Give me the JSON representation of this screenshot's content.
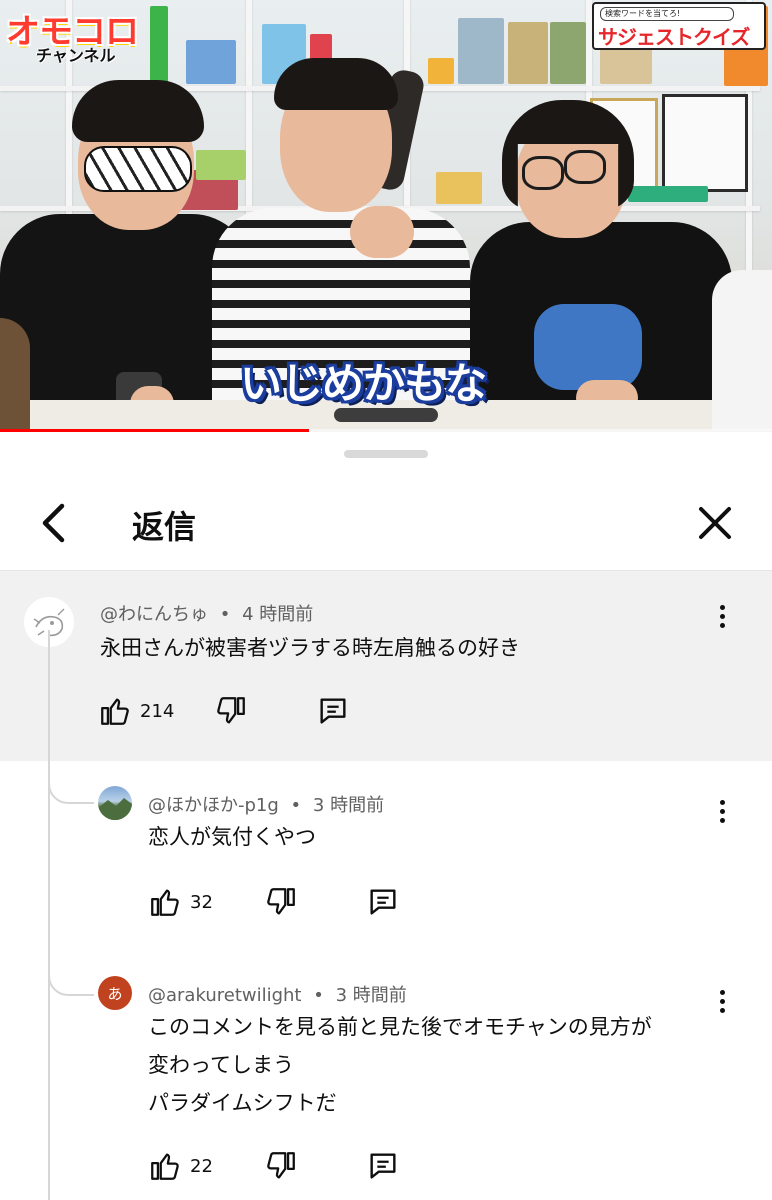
{
  "video": {
    "channel_logo": "オモコロ",
    "channel_logo_sub": "チャンネル",
    "quiz_badge_search": "検索ワードを当てろ!",
    "quiz_badge_title": "サジェストクイズ",
    "caption": "いじめかもな",
    "progress": 0.4
  },
  "sheet": {
    "title": "返信",
    "back_icon": "chevron-left-icon",
    "close_icon": "close-icon"
  },
  "comments": [
    {
      "author": "@わにんちゅ",
      "separator": "•",
      "time": "4 時間前",
      "lines": [
        "永田さんが被害者ヅラする時左肩触るの好き"
      ],
      "likes": "214",
      "avatar_kind": "sketch"
    },
    {
      "author": "@ほかほか-p1g",
      "separator": "•",
      "time": "3 時間前",
      "lines": [
        "恋人が気付くやつ"
      ],
      "likes": "32",
      "avatar_kind": "landscape"
    },
    {
      "author": "@arakuretwilight",
      "separator": "•",
      "time": "3 時間前",
      "lines": [
        "このコメントを見る前と見た後でオモチャンの見方が",
        "変わってしまう",
        "パラダイムシフトだ"
      ],
      "likes": "22",
      "avatar_kind": "letter",
      "avatar_letter": "あ",
      "avatar_color": "#c0421f"
    }
  ],
  "icons": {
    "like": "thumbs-up-icon",
    "dislike": "thumbs-down-icon",
    "reply": "comment-icon",
    "more": "more-vert-icon"
  },
  "colors": {
    "progress": "#ff0000",
    "caption_outline": "#1a3d9e",
    "parent_bg": "#f1f1f1"
  }
}
